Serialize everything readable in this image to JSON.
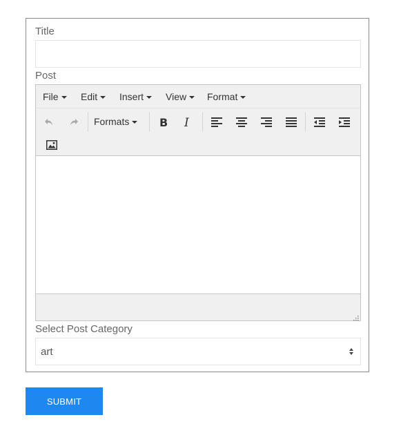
{
  "form": {
    "title_label": "Title",
    "title_value": "",
    "post_label": "Post",
    "category_label": "Select Post Category",
    "category_selected": "art",
    "submit_label": "SUBMIT"
  },
  "editor": {
    "menubar": [
      "File",
      "Edit",
      "Insert",
      "View",
      "Format"
    ],
    "formats_label": "Formats",
    "content": ""
  },
  "colors": {
    "submit_bg": "#1e88f0",
    "editor_chrome": "#f0f0f0"
  },
  "icons": {
    "toolbar": [
      "undo-icon",
      "redo-icon",
      "bold-icon",
      "italic-icon",
      "align-left-icon",
      "align-center-icon",
      "align-right-icon",
      "align-justify-icon",
      "outdent-icon",
      "indent-icon",
      "image-icon"
    ]
  }
}
